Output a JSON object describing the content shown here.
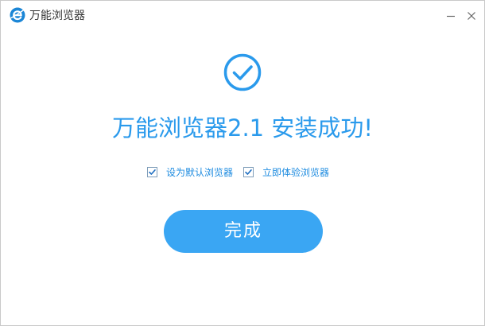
{
  "window": {
    "title": "万能浏览器",
    "logo_icon": "browser-e-logo-icon",
    "controls": {
      "minimize_icon": "minimize-icon",
      "close_icon": "close-icon"
    }
  },
  "main": {
    "status_icon": "check-circle-icon",
    "headline": "万能浏览器2.1 安装成功!",
    "options": [
      {
        "label": "设为默认浏览器",
        "checked": true
      },
      {
        "label": "立即体验浏览器",
        "checked": true
      }
    ],
    "finish_label": "完成"
  },
  "colors": {
    "accent": "#2a9aec",
    "button": "#3aa6f3",
    "logo": "#1b86d6"
  }
}
